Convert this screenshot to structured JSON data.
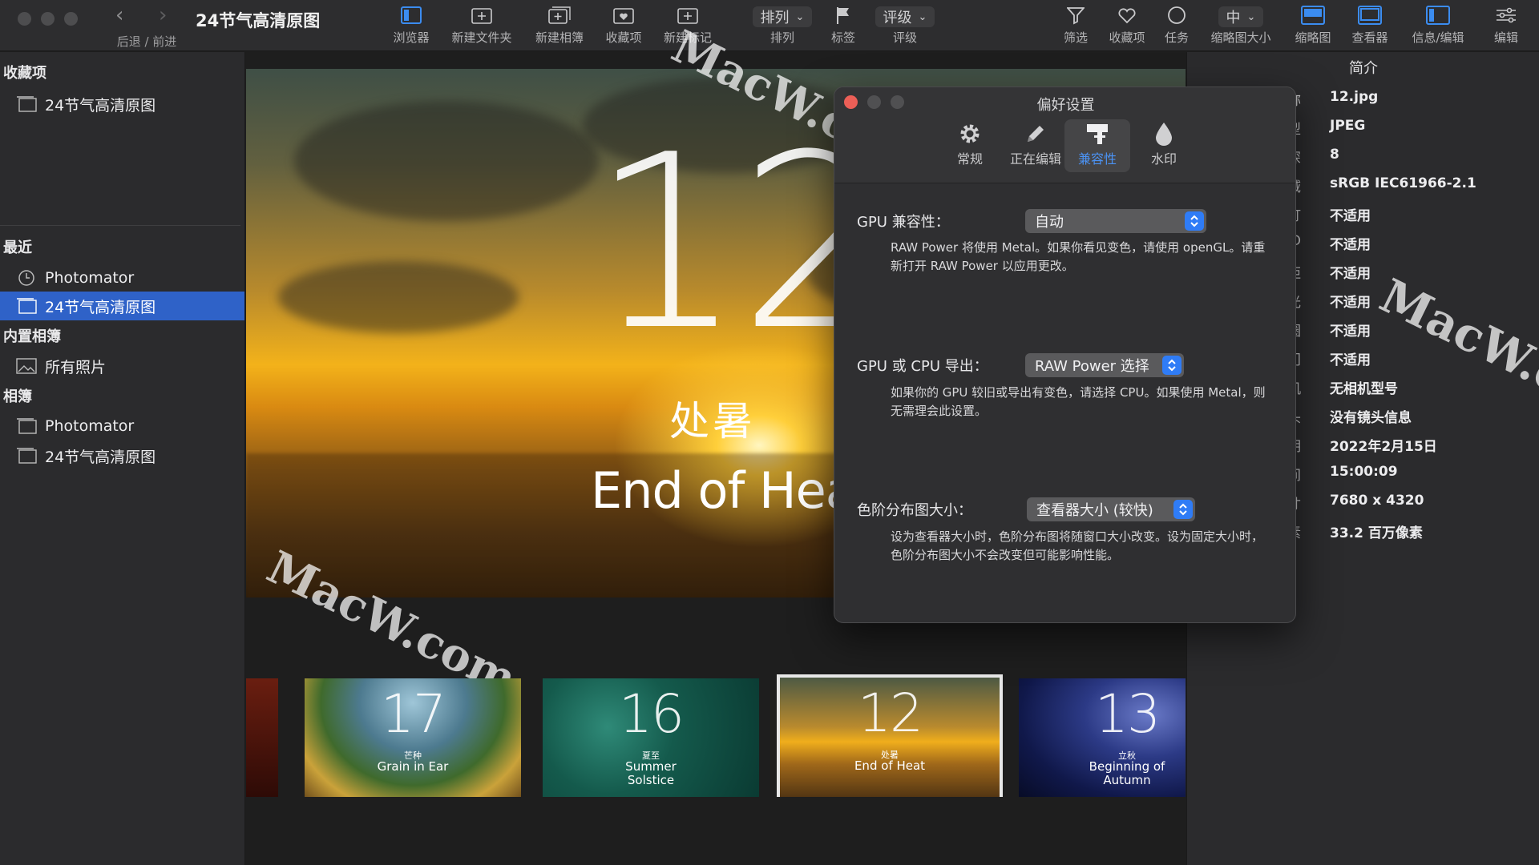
{
  "window": {
    "title": "24节气高清原图"
  },
  "toolbar": {
    "nav_label": "后退 / 前进",
    "items": [
      {
        "id": "browser",
        "label": "浏览器"
      },
      {
        "id": "new-folder",
        "label": "新建文件夹"
      },
      {
        "id": "new-album",
        "label": "新建相簿"
      },
      {
        "id": "favorites",
        "label": "收藏项"
      },
      {
        "id": "new-tag",
        "label": "新建标记"
      },
      {
        "id": "sort",
        "label": "排列",
        "value": "排列"
      },
      {
        "id": "tags",
        "label": "标签"
      },
      {
        "id": "rating",
        "label": "评级",
        "value": "评级"
      },
      {
        "id": "filter",
        "label": "筛选"
      },
      {
        "id": "fav2",
        "label": "收藏项"
      },
      {
        "id": "tasks",
        "label": "任务"
      },
      {
        "id": "thumb-size",
        "label": "缩略图大小",
        "value": "中"
      },
      {
        "id": "thumbs",
        "label": "缩略图"
      },
      {
        "id": "viewer",
        "label": "查看器"
      },
      {
        "id": "info-edit",
        "label": "信息/编辑"
      },
      {
        "id": "edit",
        "label": "编辑"
      }
    ]
  },
  "sidebar": {
    "sections": [
      {
        "title": "收藏项",
        "items": [
          {
            "label": "24节气高清原图",
            "icon": "album-icon",
            "selected": false
          }
        ]
      },
      {
        "title": "最近",
        "items": [
          {
            "label": "Photomator",
            "icon": "clock-icon",
            "selected": false
          },
          {
            "label": "24节气高清原图",
            "icon": "album-icon",
            "selected": true
          }
        ]
      },
      {
        "title": "内置相簿",
        "items": [
          {
            "label": "所有照片",
            "icon": "photos-icon",
            "selected": false
          }
        ]
      },
      {
        "title": "相簿",
        "items": [
          {
            "label": "Photomator",
            "icon": "album-icon",
            "selected": false
          },
          {
            "label": "24节气高清原图",
            "icon": "album-icon",
            "selected": false
          }
        ]
      }
    ]
  },
  "viewer": {
    "photo": {
      "number": "12",
      "cn": "处暑",
      "en": "End of Heat"
    },
    "watermark": "MacW.com",
    "filmstrip": [
      {
        "number": "17",
        "cn": "芒种",
        "en": "Grain in Ear"
      },
      {
        "number": "16",
        "cn": "夏至",
        "en": "Summer Solstice"
      },
      {
        "number": "12",
        "cn": "处暑",
        "en": "End of Heat",
        "selected": true
      },
      {
        "number": "13",
        "cn": "立秋",
        "en": "Beginning of Autumn"
      }
    ]
  },
  "info": {
    "title": "简介",
    "rows": [
      {
        "key": "文件名称",
        "value": "12.jpg"
      },
      {
        "key": "类型",
        "value": "JPEG"
      },
      {
        "key": "位深",
        "value": "8"
      },
      {
        "key": "色域",
        "value": "sRGB IEC61966-2.1"
      },
      {
        "key": "闪光灯",
        "value": "不适用"
      },
      {
        "key": "ISO",
        "value": "不适用"
      },
      {
        "key": "焦距",
        "value": "不适用"
      },
      {
        "key": "曝光",
        "value": "不适用"
      },
      {
        "key": "光圈",
        "value": "不适用"
      },
      {
        "key": "快门",
        "value": "不适用"
      },
      {
        "key": "相机",
        "value": "无相机型号"
      },
      {
        "key": "镜头",
        "value": "没有镜头信息"
      },
      {
        "key": "日期",
        "value": "2022年2月15日"
      },
      {
        "key": "时间",
        "value": "15:00:09"
      },
      {
        "key": "尺寸",
        "value": "7680 x 4320"
      },
      {
        "key": "像素",
        "value": "33.2 百万像素"
      }
    ]
  },
  "prefs": {
    "title": "偏好设置",
    "tabs": [
      {
        "label": "常规",
        "icon": "gear-icon",
        "selected": false
      },
      {
        "label": "正在编辑",
        "icon": "pencil-icon",
        "selected": false
      },
      {
        "label": "兼容性",
        "icon": "puzzle-icon",
        "selected": true
      },
      {
        "label": "水印",
        "icon": "drop-icon",
        "selected": false
      }
    ],
    "settings": [
      {
        "label": "GPU 兼容性：",
        "value": "自动",
        "desc": "RAW Power 将使用 Metal。如果你看见变色，请使用 openGL。请重新打开 RAW Power 以应用更改。"
      },
      {
        "label": "GPU 或 CPU 导出：",
        "value": "RAW Power 选择",
        "desc": "如果你的 GPU 较旧或导出有变色，请选择 CPU。如果使用 Metal，则无需理会此设置。"
      },
      {
        "label": "色阶分布图大小：",
        "value": "查看器大小 (较快)",
        "desc": "设为查看器大小时，色阶分布图将随窗口大小改变。设为固定大小时， 色阶分布图大小不会改变但可能影响性能。"
      }
    ]
  },
  "colors": {
    "accent": "#2f7cf6",
    "selection": "#2f62c8",
    "close": "#ec5f57"
  }
}
